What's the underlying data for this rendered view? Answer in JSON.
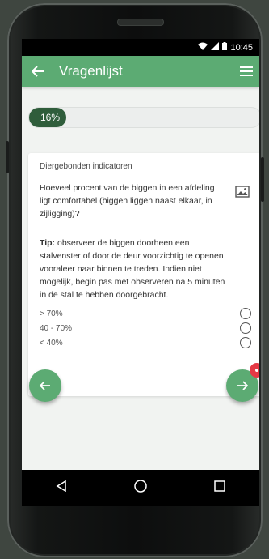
{
  "status": {
    "time": "10:45"
  },
  "appbar": {
    "title": "Vragenlijst",
    "back_icon": "arrow-left-icon",
    "menu_icon": "hamburger-menu-icon"
  },
  "progress": {
    "label": "16%",
    "value": 0.16
  },
  "card": {
    "section_title": "Diergebonden indicatoren",
    "question": "Hoeveel procent van de biggen in een afdeling ligt comfortabel (biggen liggen naast elkaar, in zijligging)?",
    "tip_prefix": "Tip:",
    "tip_text": "observeer de biggen doorheen een stalvenster of door de deur voorzichtig te openen vooraleer naar binnen te treden. Indien niet mogelijk, begin pas met observeren na 5 minuten in de stal te hebben doorgebracht.",
    "options": [
      {
        "label": "> 70%"
      },
      {
        "label": "40 - 70%"
      },
      {
        "label": "< 40%"
      }
    ]
  },
  "colors": {
    "accent": "#5cab73",
    "progress_fill": "#2f5d3b",
    "badge": "#e53945"
  }
}
